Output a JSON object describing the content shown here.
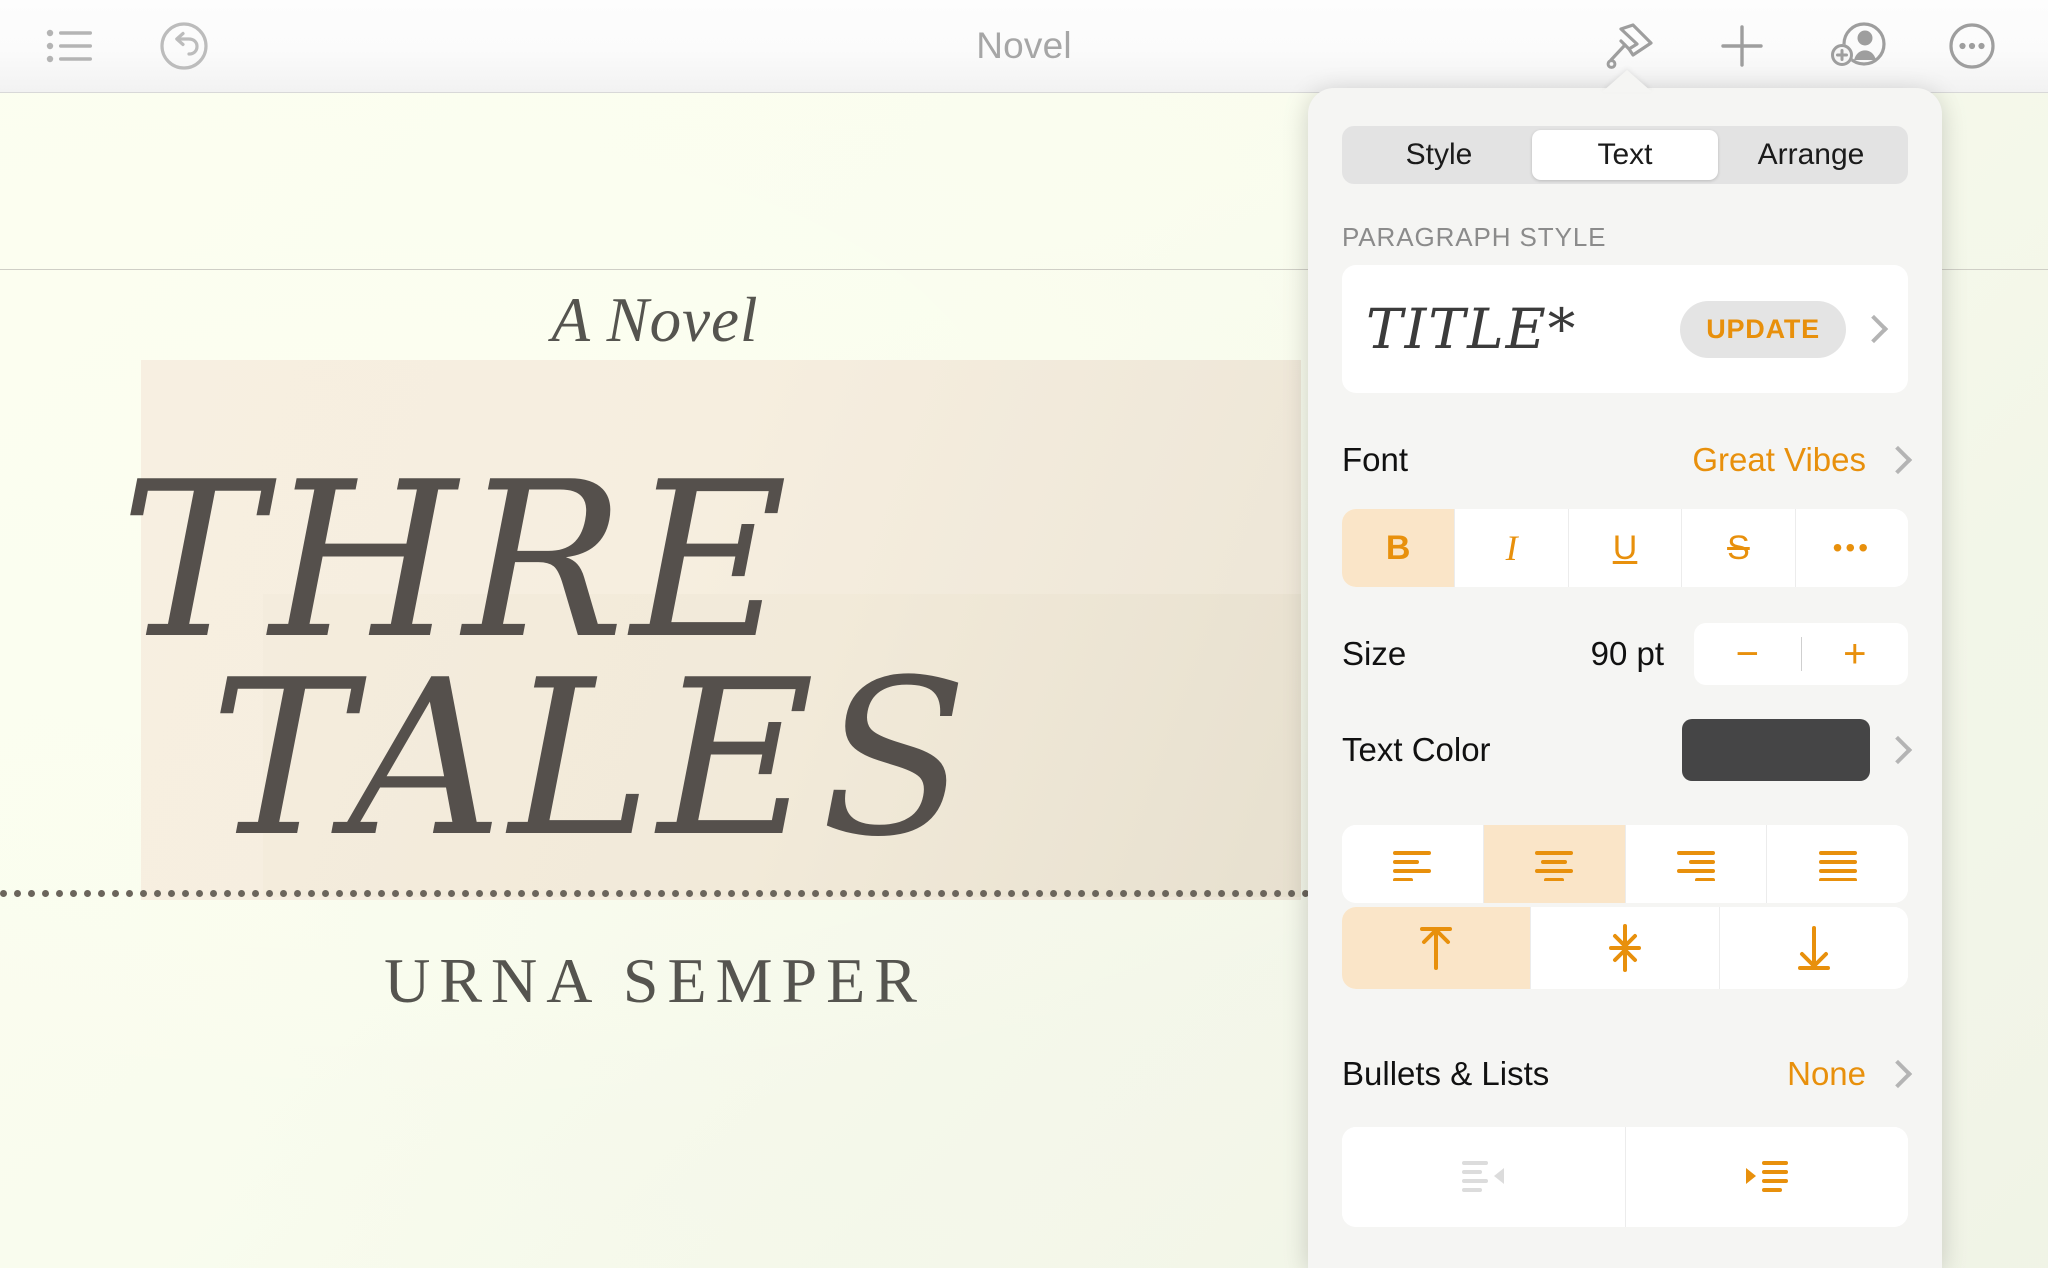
{
  "toolbar": {
    "title": "Novel",
    "icons": {
      "doc_list": "document-list-icon",
      "undo": "undo-icon",
      "format": "paintbrush-icon",
      "insert": "plus-icon",
      "collaborate": "add-person-icon",
      "more": "more-ellipsis-icon"
    }
  },
  "document": {
    "subtitle": "A Novel",
    "title_line1": "THRE",
    "title_line2": "TALES",
    "footer": "URNA SEMPER"
  },
  "panel": {
    "tabs": [
      {
        "label": "Style",
        "active": false
      },
      {
        "label": "Text",
        "active": true
      },
      {
        "label": "Arrange",
        "active": false
      }
    ],
    "paragraph_style": {
      "section_label": "PARAGRAPH STYLE",
      "preview_text": "TITLE*",
      "update_label": "UPDATE"
    },
    "font": {
      "label": "Font",
      "value": "Great Vibes"
    },
    "format_buttons": [
      {
        "name": "bold",
        "glyph": "B",
        "active": true
      },
      {
        "name": "italic",
        "glyph": "I",
        "active": false
      },
      {
        "name": "underline",
        "glyph": "U",
        "active": false
      },
      {
        "name": "strikethrough",
        "glyph": "S",
        "active": false
      },
      {
        "name": "more",
        "glyph": "•••",
        "active": false
      }
    ],
    "size": {
      "label": "Size",
      "value": "90 pt",
      "decrement": "−",
      "increment": "+"
    },
    "text_color": {
      "label": "Text Color",
      "swatch_hex": "#454546"
    },
    "align_horizontal": [
      {
        "name": "align-left",
        "active": false
      },
      {
        "name": "align-center",
        "active": true
      },
      {
        "name": "align-right",
        "active": false
      },
      {
        "name": "align-justify",
        "active": false
      }
    ],
    "align_vertical": [
      {
        "name": "align-top",
        "active": true
      },
      {
        "name": "align-middle",
        "active": false
      },
      {
        "name": "align-bottom",
        "active": false
      }
    ],
    "bullets": {
      "label": "Bullets & Lists",
      "value": "None"
    },
    "indent_buttons": [
      {
        "name": "decrease-indent",
        "enabled": false
      },
      {
        "name": "increase-indent",
        "enabled": true
      }
    ]
  },
  "colors": {
    "accent": "#e8900c",
    "accent_bg": "#fae5c8",
    "panel_bg": "#f5f5f3",
    "text_dark": "#111111",
    "muted": "#8b8b8b"
  }
}
